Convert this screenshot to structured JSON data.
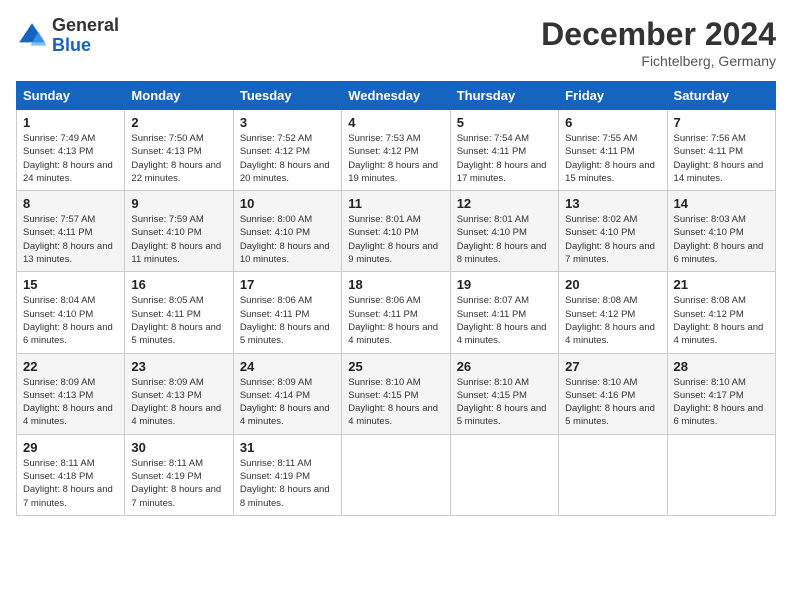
{
  "header": {
    "logo_general": "General",
    "logo_blue": "Blue",
    "month": "December 2024",
    "location": "Fichtelberg, Germany"
  },
  "weekdays": [
    "Sunday",
    "Monday",
    "Tuesday",
    "Wednesday",
    "Thursday",
    "Friday",
    "Saturday"
  ],
  "weeks": [
    [
      {
        "day": "1",
        "sunrise": "7:49 AM",
        "sunset": "4:13 PM",
        "daylight": "8 hours and 24 minutes."
      },
      {
        "day": "2",
        "sunrise": "7:50 AM",
        "sunset": "4:13 PM",
        "daylight": "8 hours and 22 minutes."
      },
      {
        "day": "3",
        "sunrise": "7:52 AM",
        "sunset": "4:12 PM",
        "daylight": "8 hours and 20 minutes."
      },
      {
        "day": "4",
        "sunrise": "7:53 AM",
        "sunset": "4:12 PM",
        "daylight": "8 hours and 19 minutes."
      },
      {
        "day": "5",
        "sunrise": "7:54 AM",
        "sunset": "4:11 PM",
        "daylight": "8 hours and 17 minutes."
      },
      {
        "day": "6",
        "sunrise": "7:55 AM",
        "sunset": "4:11 PM",
        "daylight": "8 hours and 15 minutes."
      },
      {
        "day": "7",
        "sunrise": "7:56 AM",
        "sunset": "4:11 PM",
        "daylight": "8 hours and 14 minutes."
      }
    ],
    [
      {
        "day": "8",
        "sunrise": "7:57 AM",
        "sunset": "4:11 PM",
        "daylight": "8 hours and 13 minutes."
      },
      {
        "day": "9",
        "sunrise": "7:59 AM",
        "sunset": "4:10 PM",
        "daylight": "8 hours and 11 minutes."
      },
      {
        "day": "10",
        "sunrise": "8:00 AM",
        "sunset": "4:10 PM",
        "daylight": "8 hours and 10 minutes."
      },
      {
        "day": "11",
        "sunrise": "8:01 AM",
        "sunset": "4:10 PM",
        "daylight": "8 hours and 9 minutes."
      },
      {
        "day": "12",
        "sunrise": "8:01 AM",
        "sunset": "4:10 PM",
        "daylight": "8 hours and 8 minutes."
      },
      {
        "day": "13",
        "sunrise": "8:02 AM",
        "sunset": "4:10 PM",
        "daylight": "8 hours and 7 minutes."
      },
      {
        "day": "14",
        "sunrise": "8:03 AM",
        "sunset": "4:10 PM",
        "daylight": "8 hours and 6 minutes."
      }
    ],
    [
      {
        "day": "15",
        "sunrise": "8:04 AM",
        "sunset": "4:10 PM",
        "daylight": "8 hours and 6 minutes."
      },
      {
        "day": "16",
        "sunrise": "8:05 AM",
        "sunset": "4:11 PM",
        "daylight": "8 hours and 5 minutes."
      },
      {
        "day": "17",
        "sunrise": "8:06 AM",
        "sunset": "4:11 PM",
        "daylight": "8 hours and 5 minutes."
      },
      {
        "day": "18",
        "sunrise": "8:06 AM",
        "sunset": "4:11 PM",
        "daylight": "8 hours and 4 minutes."
      },
      {
        "day": "19",
        "sunrise": "8:07 AM",
        "sunset": "4:11 PM",
        "daylight": "8 hours and 4 minutes."
      },
      {
        "day": "20",
        "sunrise": "8:08 AM",
        "sunset": "4:12 PM",
        "daylight": "8 hours and 4 minutes."
      },
      {
        "day": "21",
        "sunrise": "8:08 AM",
        "sunset": "4:12 PM",
        "daylight": "8 hours and 4 minutes."
      }
    ],
    [
      {
        "day": "22",
        "sunrise": "8:09 AM",
        "sunset": "4:13 PM",
        "daylight": "8 hours and 4 minutes."
      },
      {
        "day": "23",
        "sunrise": "8:09 AM",
        "sunset": "4:13 PM",
        "daylight": "8 hours and 4 minutes."
      },
      {
        "day": "24",
        "sunrise": "8:09 AM",
        "sunset": "4:14 PM",
        "daylight": "8 hours and 4 minutes."
      },
      {
        "day": "25",
        "sunrise": "8:10 AM",
        "sunset": "4:15 PM",
        "daylight": "8 hours and 4 minutes."
      },
      {
        "day": "26",
        "sunrise": "8:10 AM",
        "sunset": "4:15 PM",
        "daylight": "8 hours and 5 minutes."
      },
      {
        "day": "27",
        "sunrise": "8:10 AM",
        "sunset": "4:16 PM",
        "daylight": "8 hours and 5 minutes."
      },
      {
        "day": "28",
        "sunrise": "8:10 AM",
        "sunset": "4:17 PM",
        "daylight": "8 hours and 6 minutes."
      }
    ],
    [
      {
        "day": "29",
        "sunrise": "8:11 AM",
        "sunset": "4:18 PM",
        "daylight": "8 hours and 7 minutes."
      },
      {
        "day": "30",
        "sunrise": "8:11 AM",
        "sunset": "4:19 PM",
        "daylight": "8 hours and 7 minutes."
      },
      {
        "day": "31",
        "sunrise": "8:11 AM",
        "sunset": "4:19 PM",
        "daylight": "8 hours and 8 minutes."
      },
      null,
      null,
      null,
      null
    ]
  ],
  "labels": {
    "sunrise": "Sunrise:",
    "sunset": "Sunset:",
    "daylight": "Daylight:"
  }
}
